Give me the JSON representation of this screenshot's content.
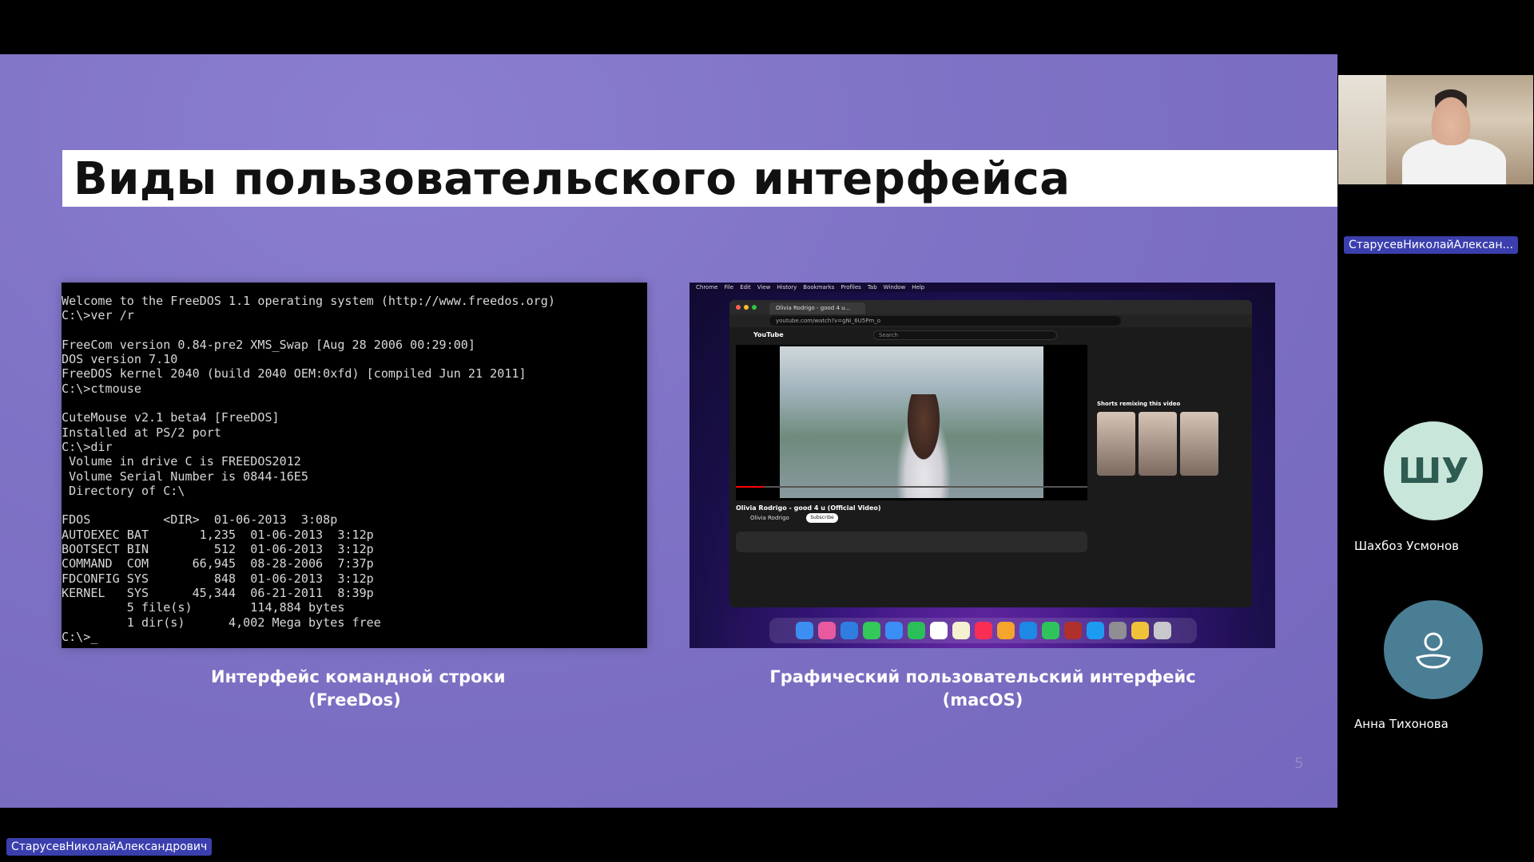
{
  "slide": {
    "title": "Виды пользовательского интерфейса",
    "terminal_lines": [
      "Welcome to the FreeDOS 1.1 operating system (http://www.freedos.org)",
      "C:\\>ver /r",
      "",
      "FreeCom version 0.84-pre2 XMS_Swap [Aug 28 2006 00:29:00]",
      "DOS version 7.10",
      "FreeDOS kernel 2040 (build 2040 OEM:0xfd) [compiled Jun 21 2011]",
      "C:\\>ctmouse",
      "",
      "CuteMouse v2.1 beta4 [FreeDOS]",
      "Installed at PS/2 port",
      "C:\\>dir",
      " Volume in drive C is FREEDOS2012",
      " Volume Serial Number is 0844-16E5",
      " Directory of C:\\",
      "",
      "FDOS          <DIR>  01-06-2013  3:08p",
      "AUTOEXEC BAT       1,235  01-06-2013  3:12p",
      "BOOTSECT BIN         512  01-06-2013  3:12p",
      "COMMAND  COM      66,945  08-28-2006  7:37p",
      "FDCONFIG SYS         848  01-06-2013  3:12p",
      "KERNEL   SYS      45,344  06-21-2011  8:39p",
      "         5 file(s)        114,884 bytes",
      "         1 dir(s)      4,002 Mega bytes free",
      "C:\\>_"
    ],
    "mac": {
      "menubar": [
        "Chrome",
        "File",
        "Edit",
        "View",
        "History",
        "Bookmarks",
        "Profiles",
        "Tab",
        "Window",
        "Help"
      ],
      "tab_title": "Olivia Rodrigo - good 4 u...",
      "url": "youtube.com/watch?v=gNi_6U5Pm_o",
      "yt_logo": "YouTube",
      "search_placeholder": "Search",
      "video_title": "Olivia Rodrigo - good 4 u (Official Video)",
      "channel": "Olivia Rodrigo",
      "subscribe": "Subscribe",
      "shorts_title": "Shorts remixing this video"
    },
    "caption_left": [
      "Интерфейс командной строки",
      "(FreeDos)"
    ],
    "caption_right": [
      "Графический пользовательский интерфейс",
      "(macOS)"
    ],
    "page_number": "5"
  },
  "participants": {
    "video_name": "СтарусевНиколайАлексан...",
    "p1_initials": "ШУ",
    "p1_name": "Шахбоз Усмонов",
    "p2_name": "Анна Тихонова",
    "self_name": "СтарусевНиколайАлександрович"
  },
  "colors": {
    "slide_bg": "#7f73c6",
    "name_tag": "#3b3fae",
    "avatar_shu": "#c8e6d9",
    "avatar_at": "#4a7e94"
  }
}
